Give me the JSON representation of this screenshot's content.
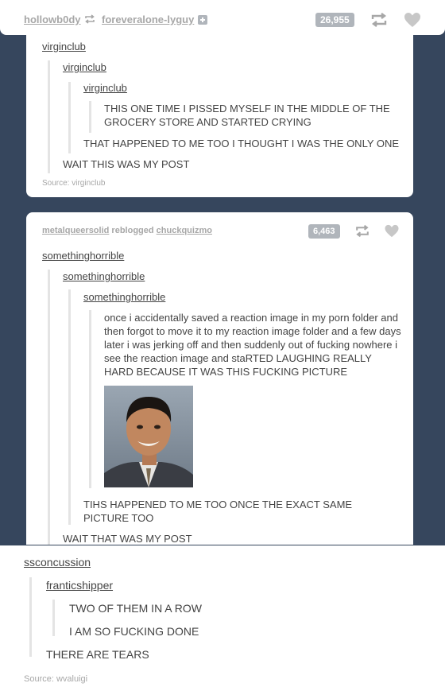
{
  "top_bar": {
    "user": "hollowb0dy",
    "reblogged_from": "foreveralone-lyguy",
    "notes": "26,955"
  },
  "post1": {
    "quote1_user": "virginclub",
    "quote2_user": "virginclub",
    "quote3_user": "virginclub",
    "quote3_text": "THIS ONE TIME I PISSED MYSELF IN THE MIDDLE OF THE GROCERY STORE AND STARTED CRYING",
    "quote2_text": "THAT HAPPENED TO ME TOO I THOUGHT I WAS THE ONLY ONE",
    "quote1_text": "WAIT THIS WAS MY POST",
    "source": "Source: virginclub"
  },
  "post2": {
    "header_user": "metalqueersolid",
    "header_action": "reblogged",
    "header_from": "chuckquizmo",
    "notes": "6,463",
    "quote1_user": "somethinghorrible",
    "quote2_user": "somethinghorrible",
    "quote3_user": "somethinghorrible",
    "quote3_text": "once i accidentally saved a reaction image in my porn folder and then forgot to move it to my reaction image folder and a few days later i was jerking off and then suddenly out of fucking nowhere i see the reaction image and staRTED LAUGHING REALLY HARD BECAUSE IT WAS THIS FUCKING PICTURE",
    "quote2_text": "TIHS HAPPENED TO ME TOO ONCE THE EXACT SAME PICTURE TOO",
    "quote1_text": "WAIT THAT WAS MY POST"
  },
  "post3": {
    "user": "ssconcussion",
    "quote_user": "franticshipper",
    "inner_line1": "TWO OF THEM IN A ROW",
    "inner_line2": "I AM SO FUCKING DONE",
    "outer_text": "THERE ARE TEARS",
    "source": "Source: wvaluigi"
  },
  "colors": {
    "dashboard": "#36465d",
    "muted": "#a7a7a7",
    "text": "#444444",
    "quote_border": "#e4e4e4"
  },
  "icons": [
    "reblog-icon",
    "heart-icon",
    "plus-icon"
  ]
}
